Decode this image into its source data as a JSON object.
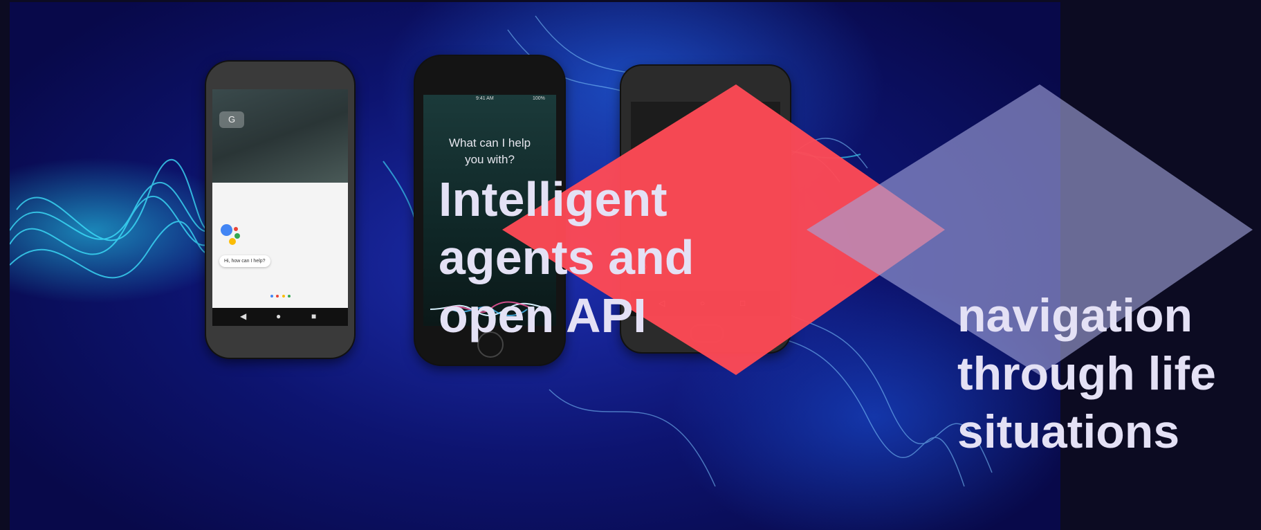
{
  "headline_left": {
    "lines": [
      "Intelligent",
      "agents and",
      "open API"
    ]
  },
  "headline_right": {
    "lines": [
      "navigation",
      "through life",
      "situations"
    ]
  },
  "phones": {
    "android_assistant": {
      "google_search_label": "G",
      "assistant_greeting": "Hi, how can I help?"
    },
    "iphone_siri": {
      "status_time": "9:41 AM",
      "status_battery": "100%",
      "siri_prompt_line1": "What can I help",
      "siri_prompt_line2": "you with?"
    }
  },
  "colors": {
    "background_dark": "#0c0b22",
    "diamond_red": "#fe4a55",
    "diamond_lavender": "#a3a4dc",
    "headline_text": "#e4e1f5"
  }
}
